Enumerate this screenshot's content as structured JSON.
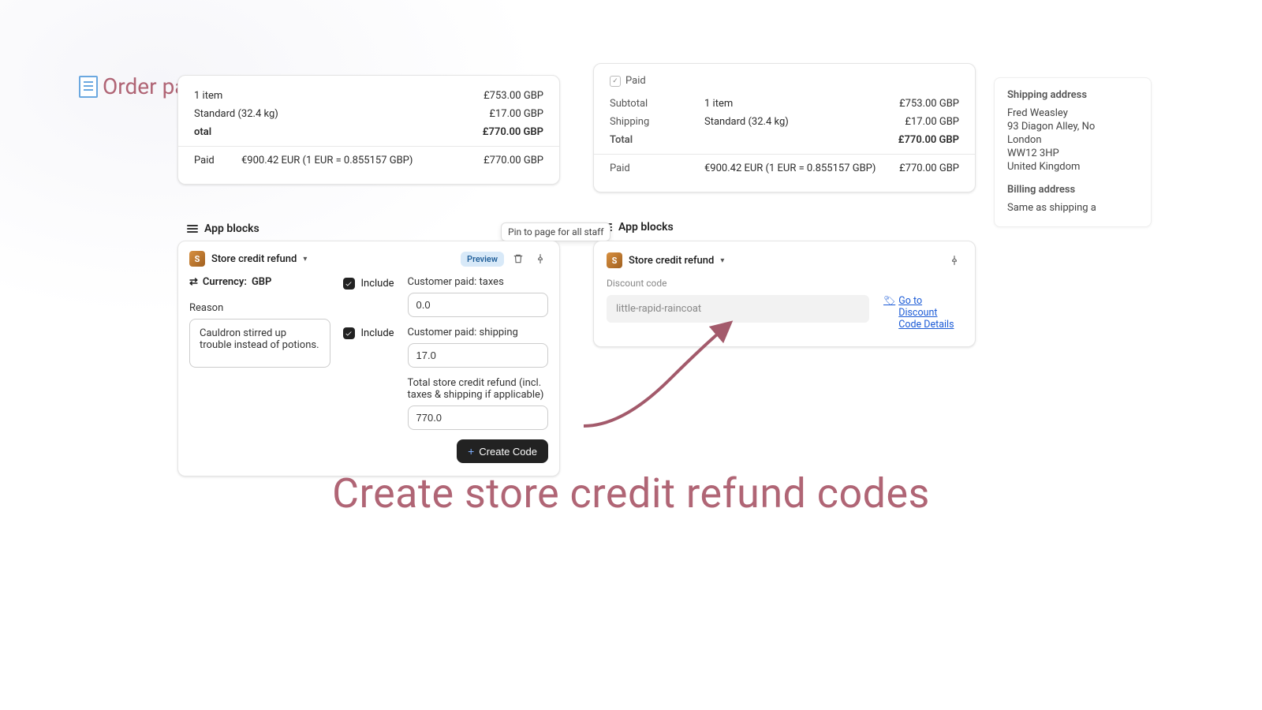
{
  "page": {
    "title": "Order page"
  },
  "orderLeft": {
    "items": "1 item",
    "itemsPrice": "£753.00 GBP",
    "shipMethod": "Standard (32.4 kg)",
    "shipPrice": "£17.00 GBP",
    "totalLabel": "otal",
    "totalPrice": "£770.00 GBP",
    "paidLabel": "Paid",
    "paidAmount": "€900.42 EUR (1 EUR = 0.855157 GBP)",
    "paidRight": "£770.00 GBP"
  },
  "orderRight": {
    "paidBadge": "Paid",
    "subtotalLabel": "Subtotal",
    "items": "1 item",
    "itemsPrice": "£753.00 GBP",
    "shipLabel": "Shipping",
    "shipMethod": "Standard (32.4 kg)",
    "shipPrice": "£17.00 GBP",
    "totalLabel": "Total",
    "totalPrice": "£770.00 GBP",
    "paidLabel": "Paid",
    "paidAmount": "€900.42 EUR (1 EUR = 0.855157 GBP)",
    "paidRight": "£770.00 GBP"
  },
  "shipping": {
    "heading": "Shipping address",
    "line1": "Fred Weasley",
    "line2": "93 Diagon Alley, No",
    "line3": "London",
    "line4": "WW12 3HP",
    "line5": "United Kingdom",
    "billingHeading": "Billing address",
    "billingText": "Same as shipping a"
  },
  "appBlocks": {
    "title": "App blocks"
  },
  "tooltip": {
    "pin": "Pin to page for all staff"
  },
  "blockLeft": {
    "title": "Store credit refund",
    "preview": "Preview",
    "currencyLabel": "Currency:",
    "currencyValue": "GBP",
    "reasonLabel": "Reason",
    "reasonValue": "Cauldron stirred up trouble instead of potions.",
    "includeLabel": "Include",
    "taxesLabel": "Customer paid: taxes",
    "taxesValue": "0.0",
    "shippingLabel": "Customer paid: shipping",
    "shippingValue": "17.0",
    "totalLabel": "Total store credit refund (incl. taxes & shipping if applicable)",
    "totalValue": "770.0",
    "createBtn": "Create Code"
  },
  "blockRight": {
    "title": "Store credit refund",
    "discountLabel": "Discount code",
    "codeValue": "little-rapid-raincoat",
    "gotoLink": "Go to Discount Code Details"
  },
  "hero": {
    "text": "Create store credit refund codes"
  }
}
